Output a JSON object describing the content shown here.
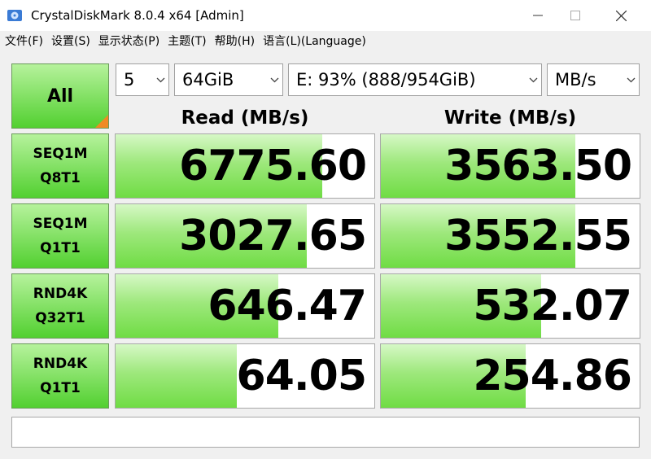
{
  "window": {
    "title": "CrystalDiskMark 8.0.4 x64 [Admin]",
    "minimize_icon": "minimize-icon",
    "maximize_icon": "maximize-icon",
    "close_icon": "close-icon"
  },
  "menu": [
    {
      "label": "文件(F)"
    },
    {
      "label": "设置(S)"
    },
    {
      "label": "显示状态(P)"
    },
    {
      "label": "主题(T)"
    },
    {
      "label": "帮助(H)"
    },
    {
      "label": "语言(L)(Language)"
    }
  ],
  "controls": {
    "all_label": "All",
    "count": "5",
    "size": "64GiB",
    "drive": "E: 93% (888/954GiB)",
    "unit": "MB/s"
  },
  "headers": {
    "read": "Read (MB/s)",
    "write": "Write (MB/s)"
  },
  "tests": [
    {
      "line1": "SEQ1M",
      "line2": "Q8T1",
      "read": "6775.60",
      "write": "3563.50",
      "read_fill": 0.8,
      "write_fill": 0.75
    },
    {
      "line1": "SEQ1M",
      "line2": "Q1T1",
      "read": "3027.65",
      "write": "3552.55",
      "read_fill": 0.74,
      "write_fill": 0.75
    },
    {
      "line1": "RND4K",
      "line2": "Q32T1",
      "read": "646.47",
      "write": "532.07",
      "read_fill": 0.63,
      "write_fill": 0.62
    },
    {
      "line1": "RND4K",
      "line2": "Q1T1",
      "read": "64.05",
      "write": "254.86",
      "read_fill": 0.47,
      "write_fill": 0.56
    }
  ],
  "colors": {
    "button_top": "#b6f29c",
    "button_bottom": "#52d030",
    "bar_green": "#6fdc44",
    "corner_orange": "#f08a24"
  }
}
